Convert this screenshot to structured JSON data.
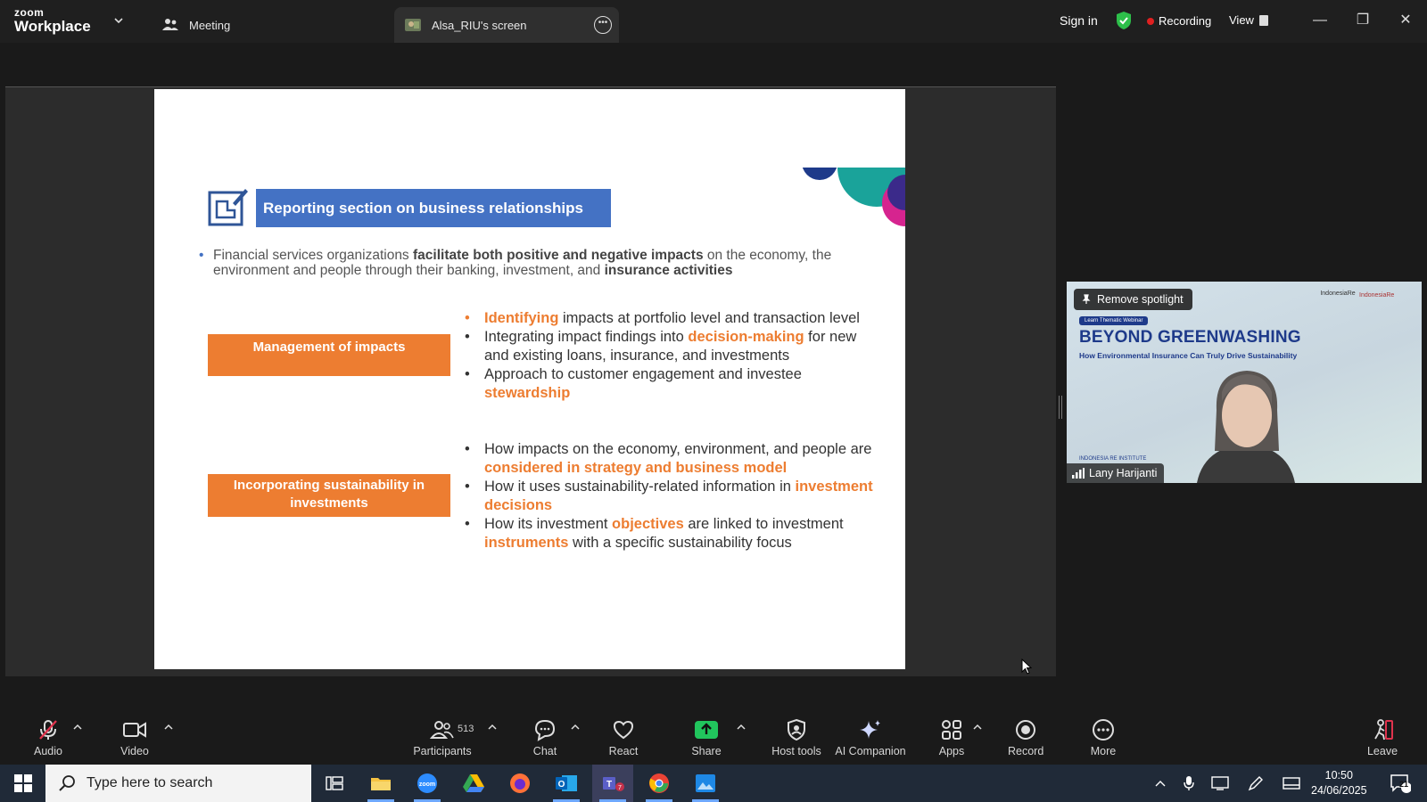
{
  "titlebar": {
    "brand_top": "zoom",
    "brand_bottom": "Workplace",
    "meeting_tab": "Meeting",
    "screen_tab": "Alsa_RIU's screen",
    "sign_in": "Sign in",
    "recording": "Recording",
    "view": "View"
  },
  "slide": {
    "title": "Reporting section on business relationships",
    "intro": {
      "p1": "Financial services organizations ",
      "b1": "facilitate both positive and negative impacts",
      "p2": " on the economy, the environment and people through their banking, investment, and ",
      "b2": "insurance activities"
    },
    "box1": "Management of impacts",
    "box2": "Incorporating sustainability in investments",
    "list1": [
      {
        "hl": "Identifying",
        "rest": " impacts at portfolio level and transaction level"
      },
      {
        "pre": "Integrating impact findings into ",
        "hl": "decision-making",
        "rest": " for new and existing loans, insurance, and investments"
      },
      {
        "pre": "Approach to customer engagement and investee ",
        "hl": "stewardship"
      }
    ],
    "list2": [
      {
        "pre": "How impacts on the economy, environment, and people are ",
        "hl": "considered in strategy and business model"
      },
      {
        "pre": "How it uses sustainability-related information in ",
        "hl": "investment decisions"
      },
      {
        "pre": "How its investment ",
        "hl": "objectives",
        "mid": " are linked to investment ",
        "hl2": "instruments",
        "rest": " with a specific sustainability focus"
      }
    ]
  },
  "video": {
    "remove_spotlight": "Remove spotlight",
    "tag": "Learn Thematic Webinar",
    "headline": "BEYOND GREENWASHING",
    "subhead": "How Environmental Insurance Can Truly Drive Sustainability",
    "logo1": "IndonesiaRe",
    "logo2": "IndonesiaRe",
    "institute": "INDONESIA RE INSTITUTE",
    "name": "Lany Harijanti"
  },
  "toolbar": {
    "audio": "Audio",
    "video": "Video",
    "participants": "Participants",
    "participant_count": "513",
    "chat": "Chat",
    "react": "React",
    "share": "Share",
    "host_tools": "Host tools",
    "ai_companion": "AI Companion",
    "apps": "Apps",
    "record": "Record",
    "more": "More",
    "leave": "Leave"
  },
  "taskbar": {
    "search_placeholder": "Type here to search",
    "time": "10:50",
    "date": "24/06/2025",
    "notifications": "21"
  },
  "colors": {
    "slide_title_bg": "#4472c4",
    "accent_orange": "#ed7d31",
    "share_green": "#21c55d",
    "recording_red": "#e02020",
    "leave_red": "#e0334d"
  }
}
